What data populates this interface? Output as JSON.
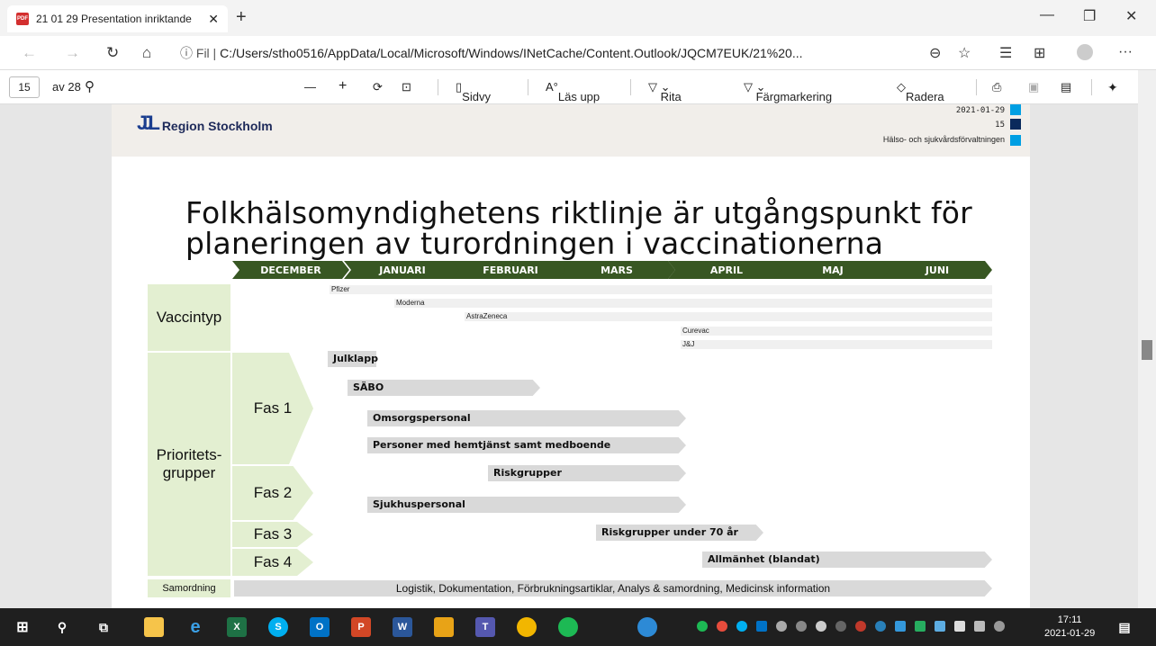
{
  "browser": {
    "tab_title": "21 01 29 Presentation inriktande",
    "close": "✕",
    "new_tab": "+",
    "url_prefix": "Fil",
    "url": "C:/Users/stho0516/AppData/Local/Microsoft/Windows/INetCache/Content.Outlook/JQCM7EUK/21%20..."
  },
  "pdf_toolbar": {
    "page": "15",
    "page_total": "av 28",
    "zoom_out": "—",
    "zoom_in": "+",
    "page_view": "Sidvy",
    "read_aloud": "Läs upp",
    "draw": "Rita",
    "highlight": "Färgmarkering",
    "erase": "Radera"
  },
  "slide": {
    "org": "Region Stockholm",
    "date": "2021-01-29",
    "page": "15",
    "department": "Hälso- och sjukvårdsförvaltningen",
    "title_line1": "Folkhälsomyndighetens riktlinje är utgångspunkt för",
    "title_line2": "planeringen av turordningen i vaccinationerna",
    "months": [
      "DECEMBER",
      "JANUARI",
      "FEBRUARI",
      "MARS",
      "APRIL",
      "MAJ",
      "JUNI"
    ],
    "cat_vaccintyp": "Vaccintyp",
    "cat_prio_1": "Prioritets-",
    "cat_prio_2": "grupper",
    "fas1": "Fas 1",
    "fas2": "Fas 2",
    "fas3": "Fas 3",
    "fas4": "Fas 4",
    "samordning": "Samordning",
    "vaccines": [
      "Pfizer",
      "Moderna",
      "AstraZeneca",
      "Curevac",
      "J&J"
    ],
    "groups": [
      "Julklapp",
      "SÄBO",
      "Omsorgspersonal",
      "Personer med hemtjänst samt medboende",
      "Riskgrupper",
      "Sjukhuspersonal",
      "Riskgrupper under 70 år",
      "Allmänhet (blandat)"
    ],
    "samordning_text": "Logistik, Dokumentation, Förbrukningsartiklar, Analys & samordning, Medicinsk information"
  },
  "taskbar": {
    "time": "17:11",
    "date": "2021-01-29"
  }
}
